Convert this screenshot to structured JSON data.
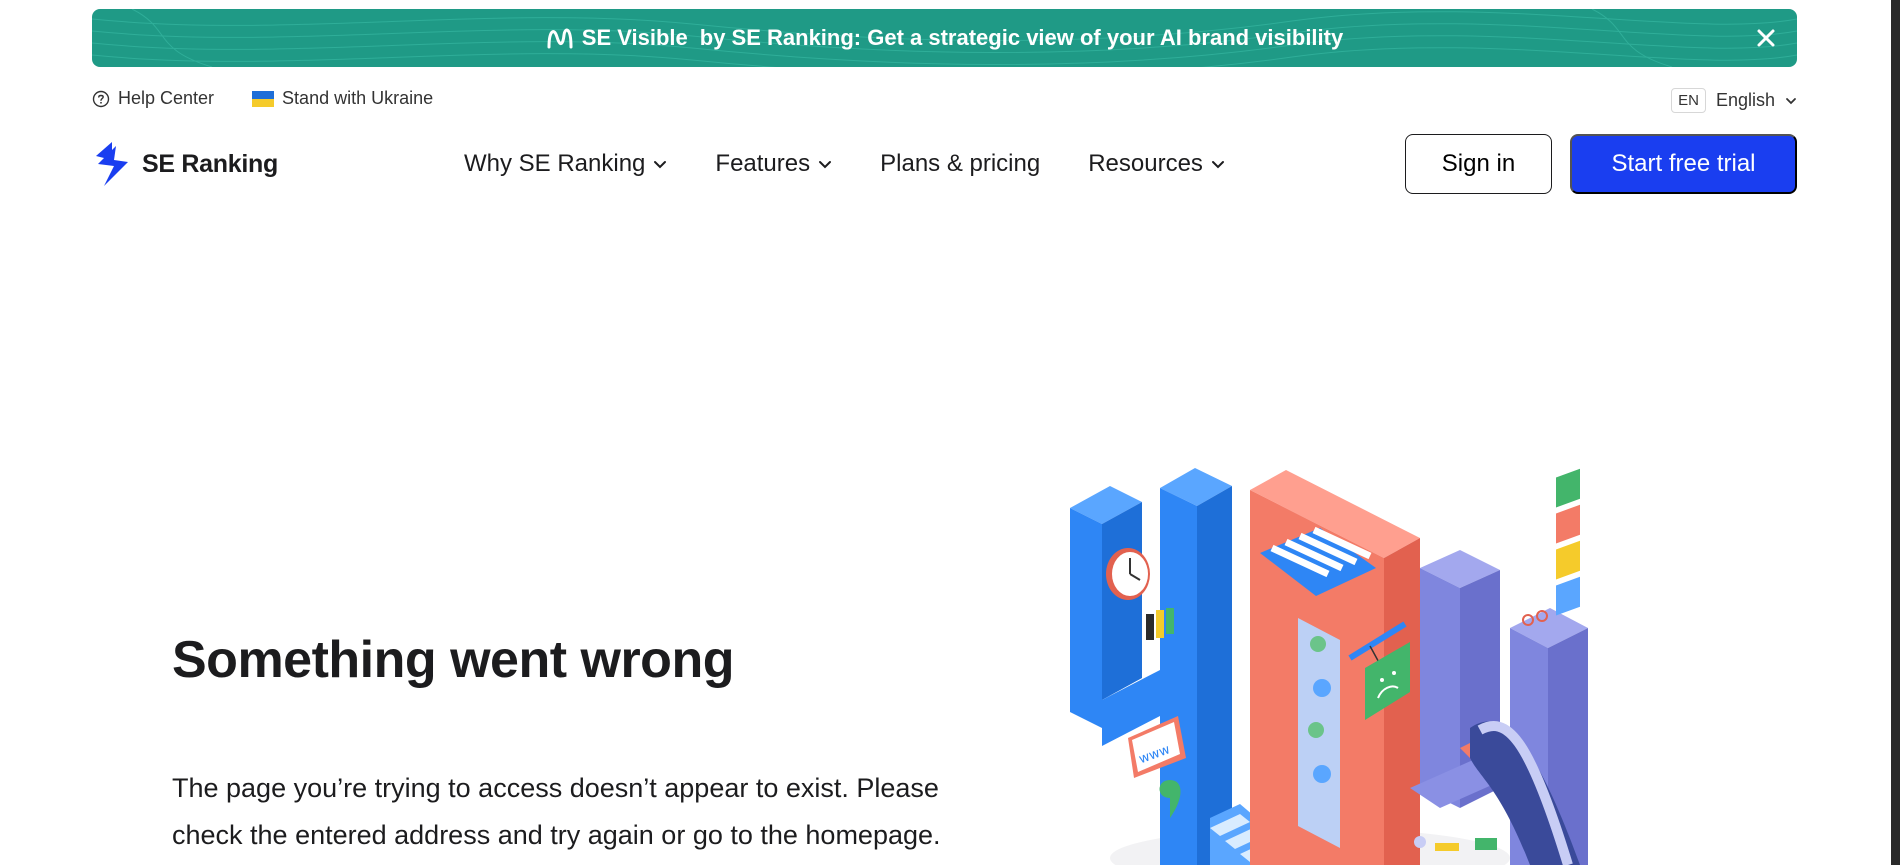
{
  "banner": {
    "brand": "SE Visible",
    "message": "by SE Ranking: Get a strategic view of your AI brand visibility"
  },
  "utility": {
    "help_center": "Help Center",
    "ukraine": "Stand with Ukraine",
    "lang_code": "EN",
    "lang_name": "English"
  },
  "logo": {
    "text": "SE Ranking"
  },
  "nav": {
    "items": [
      {
        "label": "Why SE Ranking"
      },
      {
        "label": "Features"
      },
      {
        "label": "Plans & pricing"
      },
      {
        "label": "Resources"
      }
    ],
    "sign_in": "Sign in",
    "start_trial": "Start free trial"
  },
  "hero": {
    "title": "Something went wrong",
    "line1": "The page you’re trying to access doesn’t appear to exist. Please",
    "line2": "check the entered address and try again or go to the homepage."
  },
  "colors": {
    "banner_bg": "#1f9a86",
    "brand_blue": "#1a3ef0",
    "illus_blue": "#2e86f5",
    "illus_coral": "#f37b67",
    "illus_purple": "#7f86de"
  }
}
